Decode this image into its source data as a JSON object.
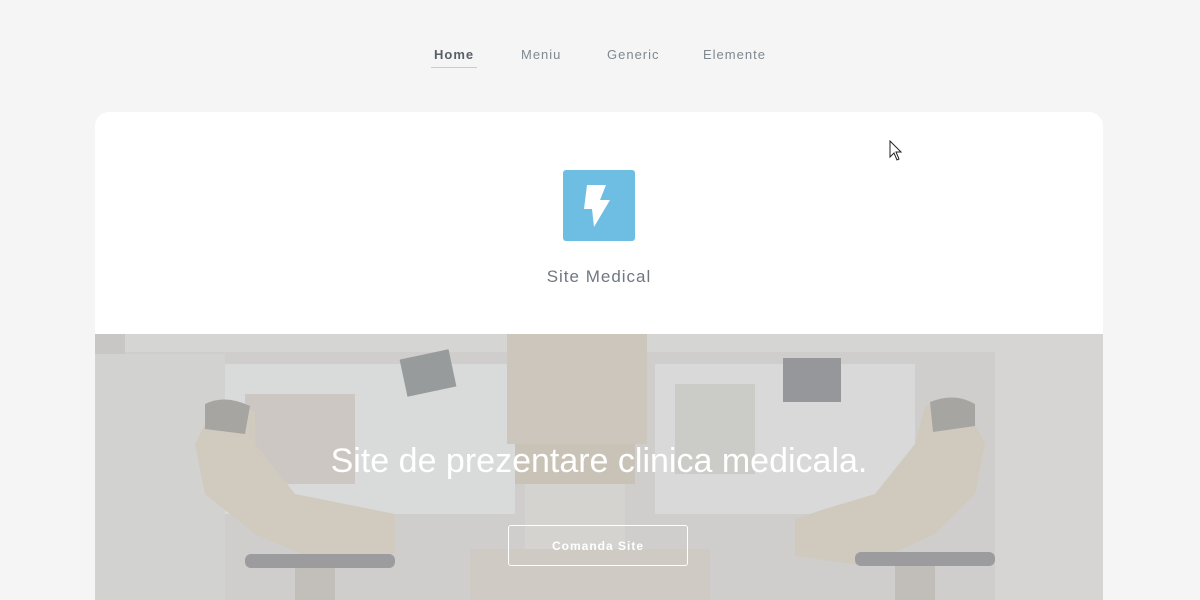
{
  "nav": {
    "items": [
      {
        "label": "Home",
        "active": true
      },
      {
        "label": "Meniu",
        "active": false
      },
      {
        "label": "Generic",
        "active": false
      },
      {
        "label": "Elemente",
        "active": false
      }
    ]
  },
  "header": {
    "logo_icon": "lightning-bolt-icon",
    "logo_color": "#6ebde2",
    "site_name": "Site Medical"
  },
  "banner": {
    "title": "Site de prezentare clinica medicala.",
    "button_label": "Comanda Site",
    "image": "dental-clinic-photo"
  }
}
